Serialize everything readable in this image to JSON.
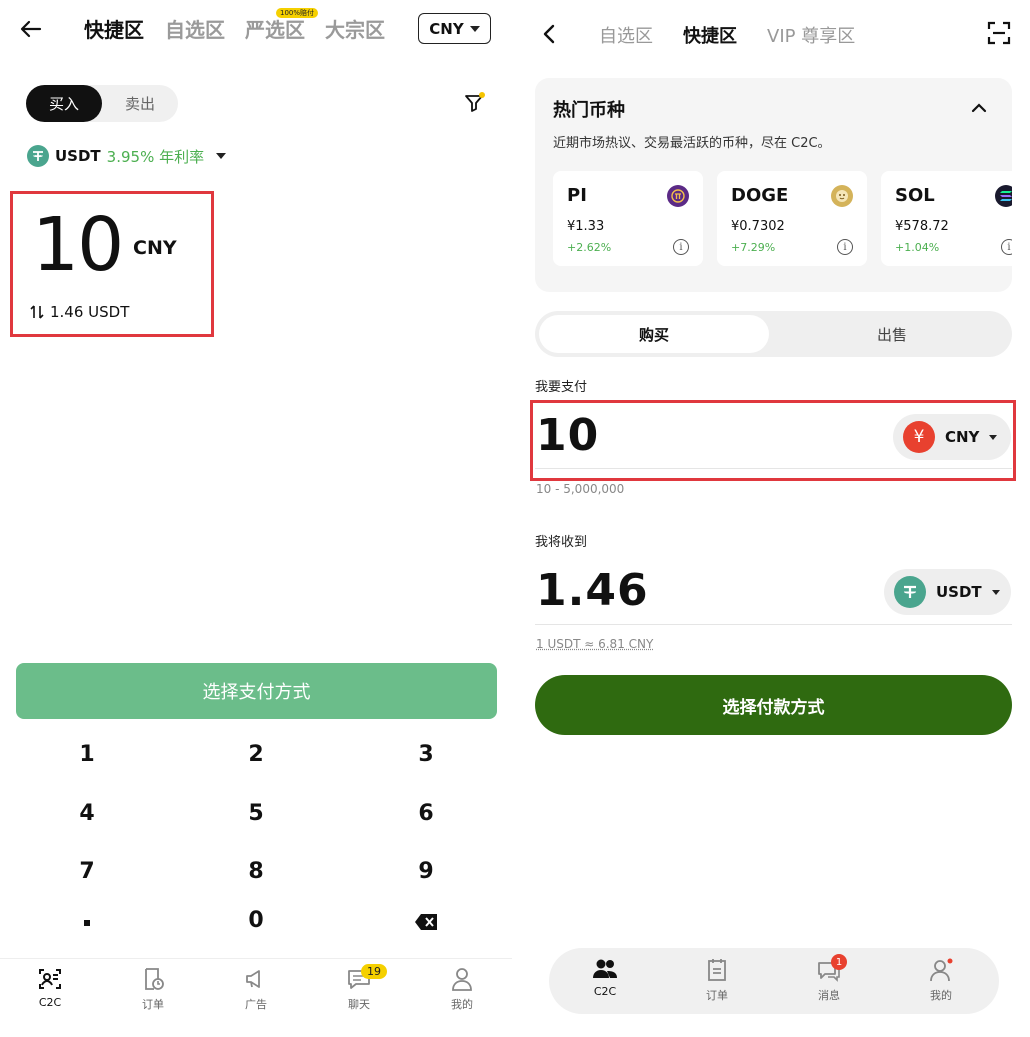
{
  "left": {
    "header": {
      "tabs": [
        "快捷区",
        "自选区",
        "严选区",
        "大宗区"
      ],
      "badge": "100%赔付",
      "currency": "CNY"
    },
    "side_toggle": {
      "buy": "买入",
      "sell": "卖出"
    },
    "coin": {
      "name": "USDT",
      "rate": "3.95% 年利率"
    },
    "amount": {
      "value": "10",
      "currency": "CNY",
      "converted": "1.46 USDT"
    },
    "pay_button": "选择支付方式",
    "keypad": [
      "1",
      "2",
      "3",
      "4",
      "5",
      "6",
      "7",
      "8",
      "9",
      "0"
    ],
    "nav": {
      "items": [
        "C2C",
        "订单",
        "广告",
        "聊天",
        "我的"
      ],
      "chat_badge": "19"
    }
  },
  "right": {
    "header": {
      "tabs": [
        "自选区",
        "快捷区",
        "VIP 尊享区"
      ]
    },
    "hot": {
      "title": "热门币种",
      "subtitle": "近期市场热议、交易最活跃的币种，尽在 C2C。",
      "coins": [
        {
          "name": "PI",
          "price": "¥1.33",
          "change": "+2.62%"
        },
        {
          "name": "DOGE",
          "price": "¥0.7302",
          "change": "+7.29%"
        },
        {
          "name": "SOL",
          "price": "¥578.72",
          "change": "+1.04%"
        }
      ]
    },
    "side_toggle": {
      "buy": "购买",
      "sell": "出售"
    },
    "pay": {
      "label": "我要支付",
      "value": "10",
      "currency": "CNY",
      "currency_symbol": "¥",
      "range": "10 - 5,000,000"
    },
    "receive": {
      "label": "我将收到",
      "value": "1.46",
      "currency": "USDT",
      "rate": "1 USDT ≈ 6.81 CNY"
    },
    "pay_button": "选择付款方式",
    "nav": {
      "items": [
        "C2C",
        "订单",
        "消息",
        "我的"
      ],
      "msg_badge": "1"
    }
  },
  "colors": {
    "accent_green": "#6bbd8a",
    "dark_green": "#2f6a10",
    "highlight_red": "#e0383e",
    "positive": "#4caf50"
  }
}
